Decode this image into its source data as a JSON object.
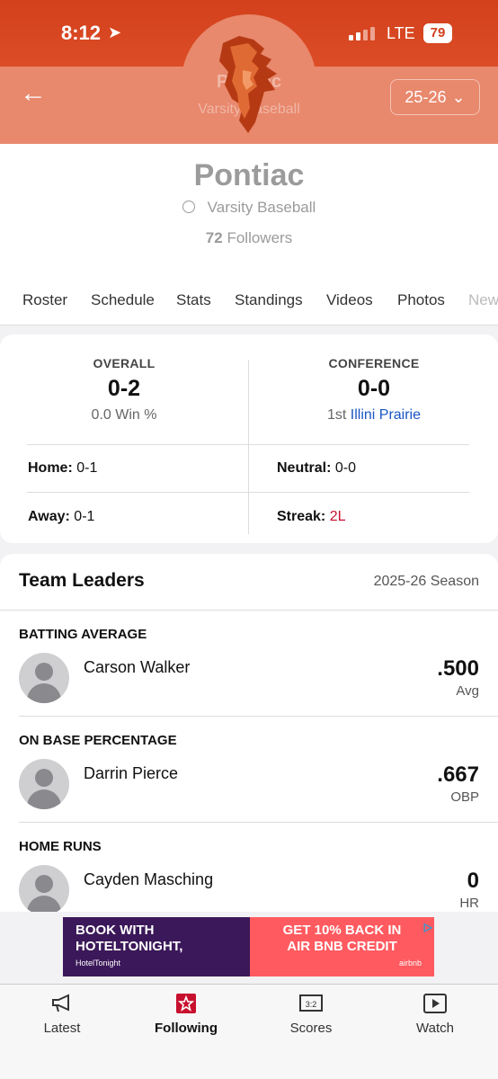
{
  "status_bar": {
    "time": "8:12",
    "network": "LTE",
    "battery": "79"
  },
  "header": {
    "ghost_title": "Pontiac",
    "ghost_subtitle": "Varsity Baseball",
    "season": "25-26"
  },
  "team": {
    "name": "Pontiac",
    "sport": "Varsity Baseball",
    "followers_count": "72",
    "followers_label": "Followers"
  },
  "tabs": [
    "Roster",
    "Schedule",
    "Stats",
    "Standings",
    "Videos",
    "Photos",
    "New"
  ],
  "record": {
    "overall_label": "OVERALL",
    "overall": "0-2",
    "win_pct": "0.0 Win %",
    "conference_label": "CONFERENCE",
    "conference": "0-0",
    "conf_rank": "1st",
    "conf_name": "Illini Prairie",
    "home_label": "Home:",
    "home": "0-1",
    "neutral_label": "Neutral:",
    "neutral": "0-0",
    "away_label": "Away:",
    "away": "0-1",
    "streak_label": "Streak:",
    "streak": "2L"
  },
  "leaders": {
    "title": "Team Leaders",
    "season": "2025-26 Season",
    "items": [
      {
        "category": "BATTING AVERAGE",
        "player": "Carson Walker",
        "value": ".500",
        "unit": "Avg"
      },
      {
        "category": "ON BASE PERCENTAGE",
        "player": "Darrin Pierce",
        "value": ".667",
        "unit": "OBP"
      },
      {
        "category": "HOME RUNS",
        "player": "Cayden Masching",
        "value": "0",
        "unit": "HR"
      }
    ]
  },
  "ad": {
    "left_line1": "BOOK WITH",
    "left_line2": "HOTELTONIGHT,",
    "left_brand": "HotelTonight",
    "right_line1": "GET 10% BACK IN",
    "right_line2": "AIR BNB CREDIT",
    "right_brand": "airbnb"
  },
  "nav": [
    "Latest",
    "Following",
    "Scores",
    "Watch"
  ],
  "colors": {
    "accent": "#d2401c",
    "link": "#1a56c6",
    "streak": "#c8102e"
  }
}
